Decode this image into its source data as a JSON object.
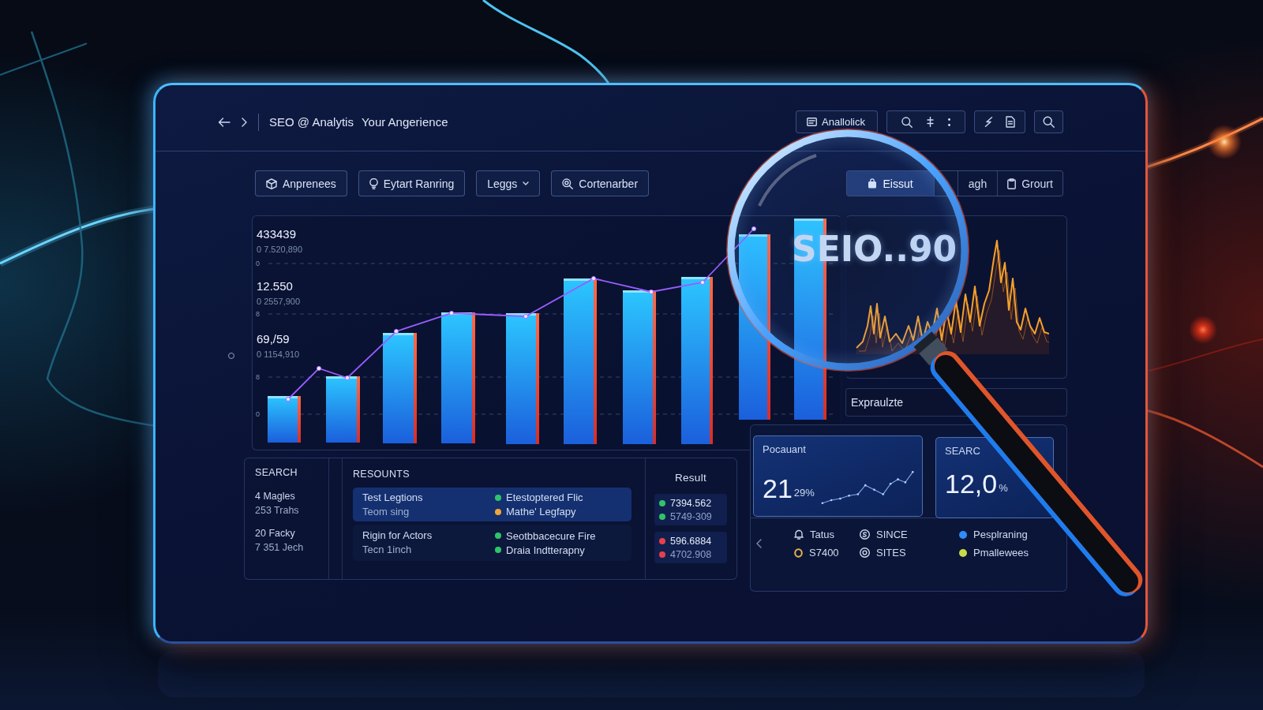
{
  "header": {
    "title": "SEO @ Analytis",
    "subtitle": "Your Angerience",
    "action_label": "Anallolick"
  },
  "toolbar": {
    "buttons": [
      {
        "label": "Anprenees",
        "kind": "icon"
      },
      {
        "label": "Eytart Ranring",
        "kind": "icon"
      },
      {
        "label": "Leggs",
        "kind": "dropdown"
      },
      {
        "label": "Cortenarber",
        "kind": "icon"
      }
    ],
    "segments": [
      {
        "label": "Eissut",
        "selected": true
      },
      {
        "label": "agh",
        "selected": false
      },
      {
        "label": "Grourt",
        "selected": false
      }
    ]
  },
  "chart": {
    "readouts": [
      {
        "value": "433439",
        "detail": "0 7.520,890"
      },
      {
        "value": "12.550",
        "detail": "0 2557,900"
      },
      {
        "value": "69,/59",
        "detail": "0 1154,910"
      }
    ],
    "gridline_labels": [
      "0",
      "8",
      "8",
      "0"
    ]
  },
  "magnifier": {
    "text": "SEIO..90"
  },
  "expand_panel": {
    "label": "Expraulzte"
  },
  "table": {
    "search": {
      "title": "SEARCH",
      "entries": [
        {
          "lines": [
            "4 Magles",
            "253 Trahs"
          ]
        },
        {
          "lines": [
            "20 Facky",
            "7 351 Jech"
          ]
        }
      ]
    },
    "resources": {
      "title": "RESOUNTS",
      "rows": [
        {
          "selected": true,
          "lines": [
            "Test Legtions",
            "Teom sing"
          ],
          "statuses": [
            {
              "label": "Etestoptered Flic",
              "color": "#2fc46a"
            },
            {
              "label": "Mathe' Legfapy",
              "color": "#f0a63a"
            }
          ]
        },
        {
          "selected": false,
          "lines": [
            "Rigin for Actors",
            "Tecn 1inch"
          ],
          "statuses": [
            {
              "label": "Seotbbacecure Fire",
              "color": "#2fc46a"
            },
            {
              "label": "Draia Indtterapny",
              "color": "#2fc46a"
            }
          ]
        }
      ]
    },
    "results": {
      "title": "Result",
      "groups": [
        {
          "items": [
            {
              "value": "7394.562",
              "color": "#2fc46a"
            },
            {
              "value": "5749-309",
              "color": "#2fc46a"
            }
          ]
        },
        {
          "items": [
            {
              "value": "596.6884",
              "color": "#e8404a"
            },
            {
              "value": "4702.908",
              "color": "#e8404a"
            }
          ]
        }
      ]
    }
  },
  "kpis": [
    {
      "label": "Pocauant",
      "value": "21",
      "unit": "29%",
      "kind": "trend"
    },
    {
      "label": "SEARC",
      "value": "12,0",
      "unit": "%",
      "kind": "plain"
    }
  ],
  "legend": {
    "columns": [
      {
        "kind": "icon",
        "items": [
          {
            "label": "Tatus"
          },
          {
            "label": "S7400"
          }
        ]
      },
      {
        "kind": "icon",
        "items": [
          {
            "label": "SINCE"
          },
          {
            "label": "SITES"
          }
        ]
      },
      {
        "kind": "dot",
        "items": [
          {
            "label": "Pesplraning",
            "color": "#2f8cff"
          },
          {
            "label": "Pmallewees",
            "color": "#c9d94a"
          }
        ]
      }
    ]
  }
}
